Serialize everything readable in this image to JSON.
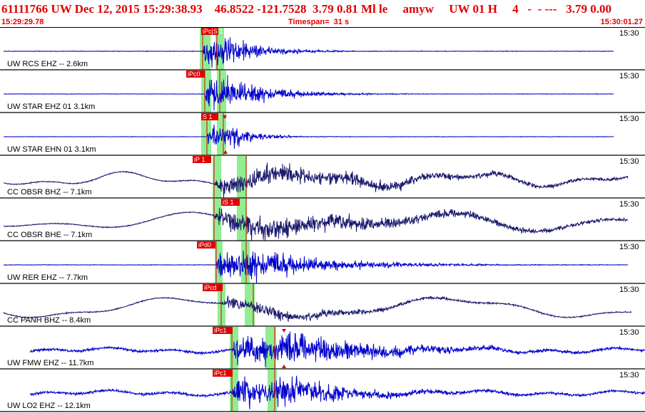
{
  "header": {
    "title": "61111766 UW Dec 12, 2015 15:29:38.93    46.8522 -121.7528  3.79 0.81 Ml le     amyw     UW 01 H     4   -  - ---   3.79 0.00",
    "start_time": "15:29:29.78",
    "timespan": "Timespan=  31 s",
    "end_time": "15:30:01.27"
  },
  "colors": {
    "header_text": "#e00000",
    "trace_blue": "#0000cc",
    "trace_navy": "#1a1a6e",
    "pick_red": "#e00000",
    "window_green": "#90ee90"
  },
  "panels": [
    {
      "label": "UW RCS EHZ -- 2.6km",
      "time_label": "15:30",
      "pick": "iPc|S 1",
      "style": "blue"
    },
    {
      "label": "UW STAR EHZ 01 3.1km",
      "time_label": "15:30",
      "pick": "iPc0",
      "style": "blue"
    },
    {
      "label": "UW STAR EHN 01 3.1km",
      "time_label": "15:30",
      "pick": "S 1",
      "style": "blue"
    },
    {
      "label": "CC OBSR BHZ -- 7.1km",
      "time_label": "15:30",
      "pick": "iP 1",
      "style": "navy"
    },
    {
      "label": "CC OBSR BHE -- 7.1km",
      "time_label": "15:30",
      "pick": "iS 1",
      "style": "navy"
    },
    {
      "label": "UW RER EHZ -- 7.7km",
      "time_label": "15:30",
      "pick": "iPd0",
      "style": "blue"
    },
    {
      "label": "CC PANH BHZ -- 8.4km",
      "time_label": "15:30",
      "pick": "iPcd",
      "style": "navy"
    },
    {
      "label": "UW FMW EHZ -- 11.7km",
      "time_label": "15:30",
      "pick": "iPc1",
      "style": "blue"
    },
    {
      "label": "UW LO2 EHZ -- 12.1km",
      "time_label": "15:30",
      "pick": "iPc1",
      "style": "blue"
    }
  ]
}
